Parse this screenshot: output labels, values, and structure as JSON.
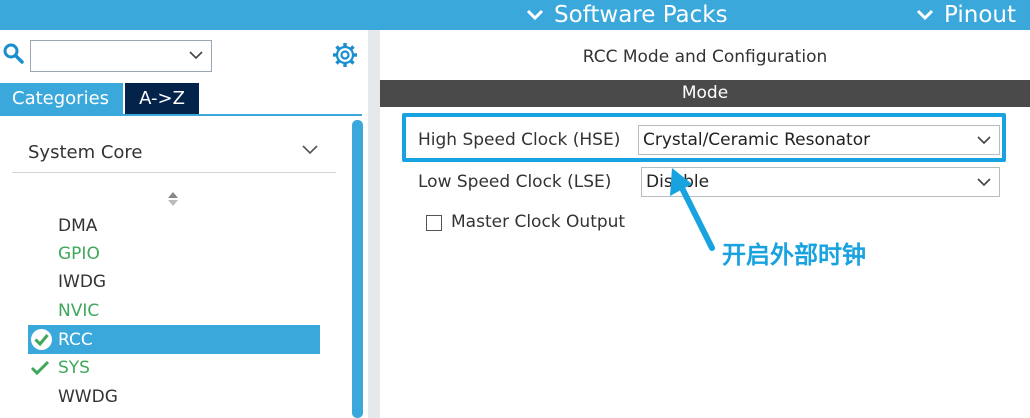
{
  "header": {
    "software_packs": "Software Packs",
    "pinout": "Pinout"
  },
  "sidebar": {
    "search": {
      "value": ""
    },
    "tabs": {
      "categories": "Categories",
      "az": "A->Z"
    },
    "section": "System Core",
    "items": [
      {
        "label": "DMA",
        "status": "none"
      },
      {
        "label": "GPIO",
        "status": "green"
      },
      {
        "label": "IWDG",
        "status": "none"
      },
      {
        "label": "NVIC",
        "status": "green"
      },
      {
        "label": "RCC",
        "status": "selected-checked"
      },
      {
        "label": "SYS",
        "status": "checked"
      },
      {
        "label": "WWDG",
        "status": "none"
      }
    ]
  },
  "main": {
    "title": "RCC Mode and Configuration",
    "mode_header": "Mode",
    "hse": {
      "label": "High Speed Clock (HSE)",
      "value": "Crystal/Ceramic Resonator"
    },
    "lse": {
      "label": "Low Speed Clock (LSE)",
      "value": "Disable"
    },
    "mco": {
      "label": "Master Clock Output",
      "checked": false
    }
  },
  "annotation": {
    "text": "开启外部时钟"
  },
  "colors": {
    "header_blue": "#3ba8dc",
    "tab_dark": "#03234b",
    "mode_bar": "#4a4a4a",
    "enabled_green": "#3da85a",
    "annotation_blue": "#18a2e0"
  }
}
